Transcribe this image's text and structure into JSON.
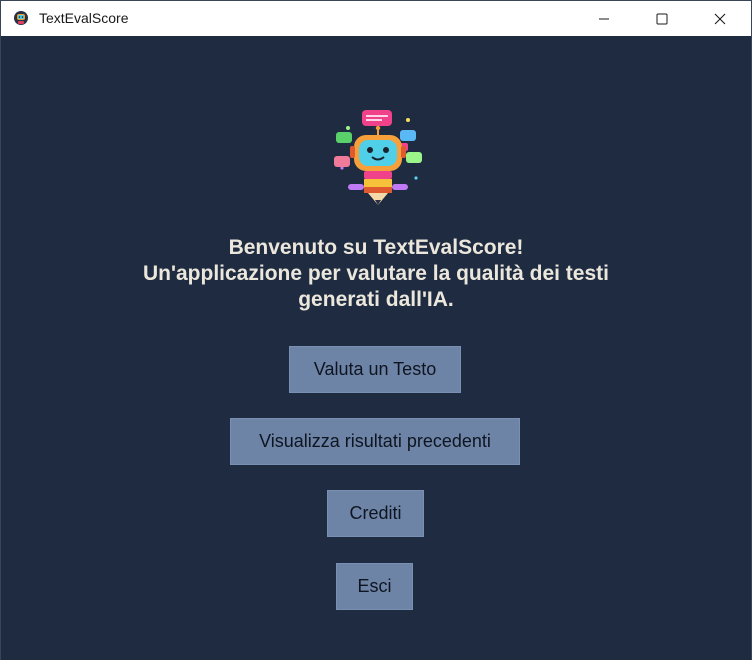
{
  "window": {
    "title": "TextEvalScore",
    "app_icon": "robot-app-icon",
    "controls": {
      "minimize_icon": "minimize-icon",
      "maximize_icon": "maximize-icon",
      "close_icon": "close-icon"
    }
  },
  "main": {
    "logo_icon": "robot-chat-logo",
    "welcome_lines": [
      "Benvenuto su TextEvalScore!",
      "Un'applicazione per valutare la qualità dei testi",
      "generati dall'IA."
    ],
    "buttons": {
      "valuta": "Valuta un Testo",
      "visualizza": "Visualizza risultati precedenti",
      "crediti": "Crediti",
      "esci": "Esci"
    }
  },
  "colors": {
    "background": "#1e2b40",
    "button": "#6d84a7",
    "heading_text": "#ece7dc",
    "titlebar": "#ffffff"
  }
}
